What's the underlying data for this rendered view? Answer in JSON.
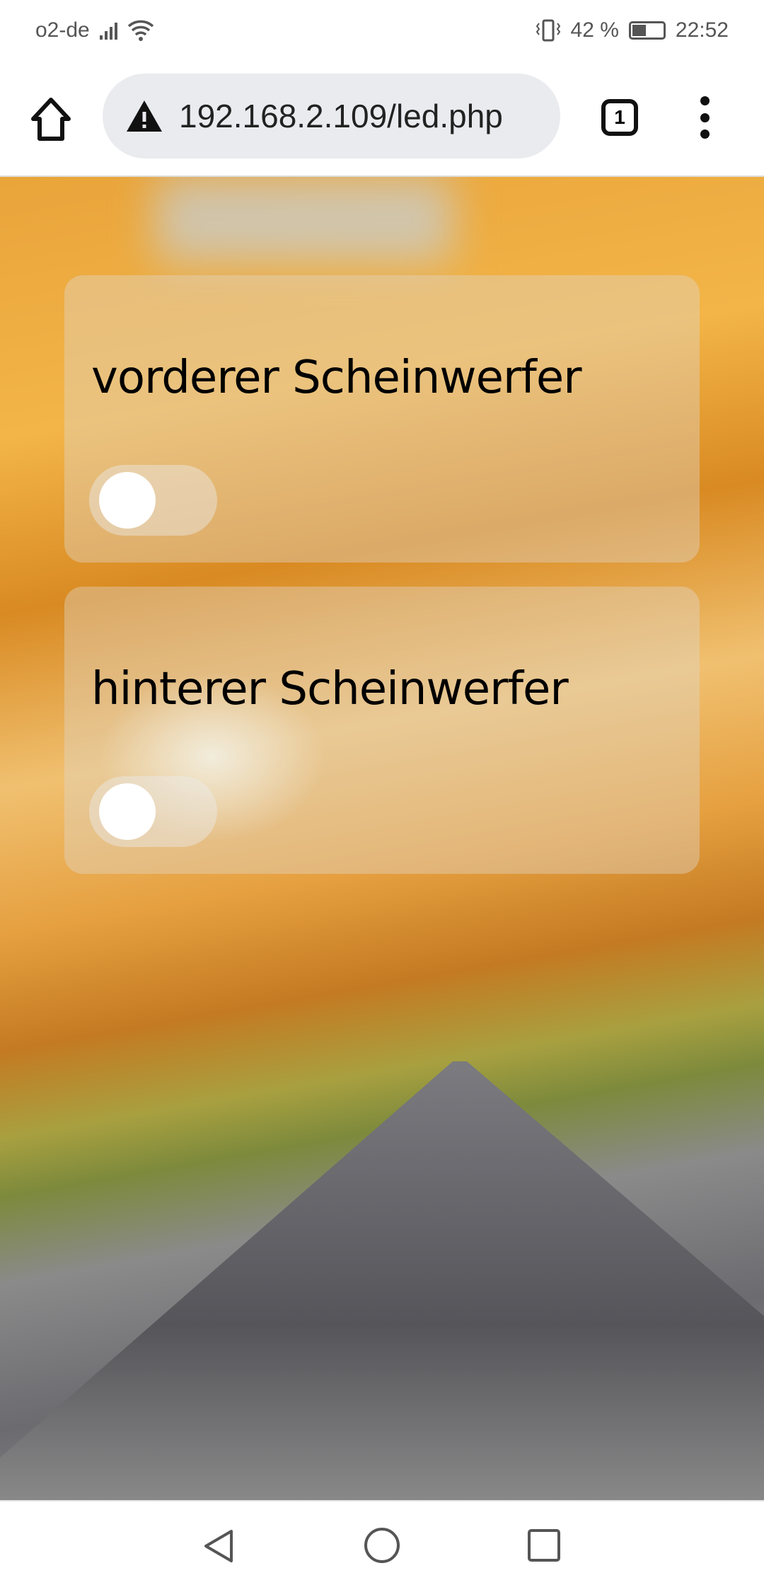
{
  "status_bar": {
    "carrier": "o2-de",
    "battery": "42 %",
    "time": "22:52"
  },
  "browser": {
    "url": "192.168.2.109/led.php",
    "tab_count": "1"
  },
  "page": {
    "switches": [
      {
        "label": "vorderer Scheinwerfer",
        "on": false
      },
      {
        "label": "hinterer Scheinwerfer",
        "on": false
      }
    ]
  }
}
